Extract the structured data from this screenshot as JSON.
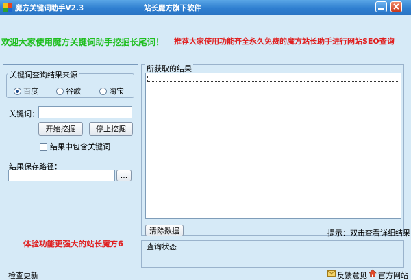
{
  "window": {
    "title": "魔方关键词助手V2.3",
    "center_title": "站长魔方旗下软件"
  },
  "banner": {
    "welcome": "欢迎大家使用魔方关键词助手挖掘长尾词！",
    "recommend": "推荐大家使用功能齐全永久免费的魔方站长助手进行网站SEO查询"
  },
  "source_group": {
    "legend": "关键词查询结果来源",
    "options": [
      "百度",
      "谷歌",
      "淘宝"
    ],
    "selected": "百度"
  },
  "keyword": {
    "label": "关键词：",
    "value": ""
  },
  "buttons": {
    "start": "开始挖掘",
    "stop": "停止挖掘",
    "clear": "清除数据",
    "browse": "..."
  },
  "include_keyword": {
    "label": "结果中包含关键词",
    "checked": false
  },
  "save_path": {
    "label": "结果保存路径：",
    "value": ""
  },
  "promo": "体验功能更强大的站长魔方6",
  "results": {
    "legend": "所获取的结果",
    "hint": "提示：双击查看详细结果"
  },
  "status": {
    "legend": "查询状态"
  },
  "footer": {
    "check_update": "检查更新",
    "feedback": "反馈意见",
    "official_site": "官方网站"
  },
  "colors": {
    "accent": "#2f7fd0",
    "green": "#1fbf1f",
    "red": "#e02020",
    "background": "#d6eaf7"
  }
}
